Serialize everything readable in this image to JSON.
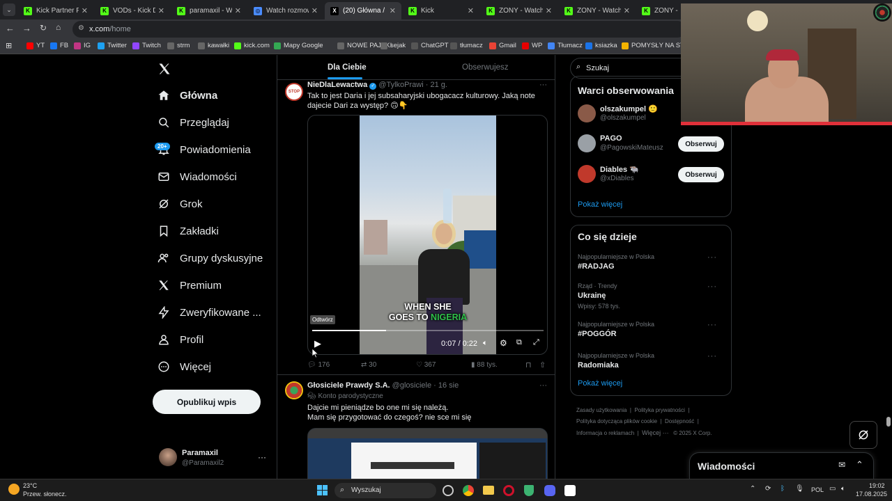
{
  "browser": {
    "tabs": [
      {
        "title": "Kick Partner Prog",
        "fav_color": "#53fc18",
        "fav_text": "K",
        "active": false
      },
      {
        "title": "VODs - Kick Dash",
        "fav_color": "#53fc18",
        "fav_text": "K",
        "active": false
      },
      {
        "title": "paramaxil - Watch",
        "fav_color": "#53fc18",
        "fav_text": "K",
        "active": false
      },
      {
        "title": "Watch rozmowa_",
        "fav_color": "#4a8cff",
        "fav_text": "◎",
        "active": false
      },
      {
        "title": "(20) Główna / X",
        "fav_color": "#000000",
        "fav_text": "X",
        "active": true
      },
      {
        "title": "Kick",
        "fav_color": "#53fc18",
        "fav_text": "K",
        "active": false
      },
      {
        "title": "ZONY - Watch clip",
        "fav_color": "#53fc18",
        "fav_text": "K",
        "active": false
      },
      {
        "title": "ZONY - Watch clip",
        "fav_color": "#53fc18",
        "fav_text": "K",
        "active": false
      },
      {
        "title": "ZONY - Wat",
        "fav_color": "#53fc18",
        "fav_text": "K",
        "active": false
      }
    ],
    "url_domain": "x.com",
    "url_path": "/home",
    "bookmarks": [
      "YT",
      "FB",
      "IG",
      "Twitter",
      "Twitch",
      "strm",
      "kawałki",
      "kick.com",
      "Mapy Google",
      "NOWE PAJĄKI",
      "sejak",
      "ChatGPT",
      "tłumacz",
      "Gmail",
      "WP",
      "Tłumacz",
      "ksiazka",
      "POMYSŁY NA STRE..."
    ]
  },
  "nav": {
    "items": [
      {
        "label": "Główna",
        "icon": "home-icon"
      },
      {
        "label": "Przeglądaj",
        "icon": "search-icon"
      },
      {
        "label": "Powiadomienia",
        "icon": "bell-icon"
      },
      {
        "label": "Wiadomości",
        "icon": "mail-icon"
      },
      {
        "label": "Grok",
        "icon": "grok-icon"
      },
      {
        "label": "Zakładki",
        "icon": "bookmark-icon"
      },
      {
        "label": "Grupy dyskusyjne",
        "icon": "people-icon"
      },
      {
        "label": "Premium",
        "icon": "x-icon"
      },
      {
        "label": "Zweryfikowane ...",
        "icon": "bolt-icon"
      },
      {
        "label": "Profil",
        "icon": "person-icon"
      },
      {
        "label": "Więcej",
        "icon": "more-icon"
      }
    ],
    "notifications_badge": "20+",
    "post_button": "Opublikuj wpis",
    "user_name": "Paramaxil",
    "user_handle": "@Paramaxil2"
  },
  "feed": {
    "tab_for_you": "Dla Ciebie",
    "tab_following": "Obserwujesz",
    "post1": {
      "name": "NieDlaLewactwa",
      "handle": "@TylkoPrawi",
      "time": "· 21 g.",
      "text": "Tak to jest Daria i jej subsaharyjski ubogacacz kulturowy. Jaką note dajecie Dari za występ? 🙃👇",
      "video_caption_1": "WHEN SHE",
      "video_caption_2a": "GOES TO ",
      "video_caption_2b": "NIGERIA",
      "tooltip": "Odtwórz",
      "time_display": "0:07 / 0:22",
      "progress": 0.32,
      "replies": "176",
      "reposts": "30",
      "likes": "367",
      "views": "88 tys."
    },
    "post2": {
      "name": "Głosiciele Prawdy S.A.",
      "handle": "@glosiciele",
      "time": "· 16 sie",
      "label": "Konto parodystyczne",
      "line1": "Dajcie mi pieniądze bo one mi się należą.",
      "line2": "Mam się przygotować do czegoś? nie sce mi się"
    }
  },
  "sidebar": {
    "search_placeholder": "Szukaj",
    "follow_title": "Warci obserwowania",
    "suggestions": [
      {
        "name": "olszakumpel 🙂",
        "handle": "@olszakumpel",
        "color": "#8a5a48"
      },
      {
        "name": "PAGO",
        "handle": "@PagowskiMateusz",
        "color": "#9aa0a6"
      },
      {
        "name": "Diables 🐃",
        "handle": "@xDiables",
        "color": "#c0392b"
      }
    ],
    "follow_label": "Obserwuj",
    "show_more": "Pokaż więcej",
    "trends_title": "Co się dzieje",
    "trends": [
      {
        "meta": "Najpopularniejsze w Polska",
        "name": "#RADJAG",
        "extra": ""
      },
      {
        "meta": "Rząd · Trendy",
        "name": "Ukrainę",
        "extra": "Wpisy: 578 tys."
      },
      {
        "meta": "Najpopularniejsze w Polska",
        "name": "#POGGÓR",
        "extra": ""
      },
      {
        "meta": "Najpopularniejsze w Polska",
        "name": "Radomiaka",
        "extra": ""
      }
    ],
    "footer": [
      "Zasady użytkowania",
      "Polityka prywatności",
      "Polityka dotycząca plików cookie",
      "Dostępność",
      "Informacja o reklamach",
      "Więcej ···",
      "© 2025 X Corp."
    ],
    "messages_title": "Wiadomości"
  },
  "taskbar": {
    "weather_temp": "23°C",
    "weather_desc": "Przew. słonecz.",
    "search": "Wyszukaj",
    "lang": "POL",
    "time": "19:02",
    "date": "17.08.2025"
  }
}
